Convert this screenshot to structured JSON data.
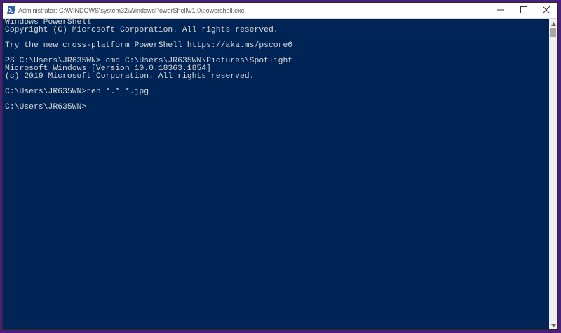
{
  "window": {
    "title": "Administrator: C:\\WINDOWS\\system32\\WindowsPowerShell\\v1.0\\powershell.exe",
    "icon": "powershell-icon"
  },
  "titlebar": {
    "minimize_icon": "minimize-icon",
    "maximize_icon": "maximize-icon",
    "close_icon": "close-icon"
  },
  "console": {
    "lines": [
      "Windows PowerShell",
      "Copyright (C) Microsoft Corporation. All rights reserved.",
      "",
      "Try the new cross-platform PowerShell https://aka.ms/pscore6",
      "",
      "PS C:\\Users\\JR635WN> cmd C:\\Users\\JR635WN\\Pictures\\Spotlight",
      "Microsoft Windows [Version 10.0.18363.1854]",
      "(c) 2019 Microsoft Corporation. All rights reserved.",
      "",
      "C:\\Users\\JR635WN>ren *.* *.jpg",
      "",
      "C:\\Users\\JR635WN>"
    ]
  },
  "scrollbar": {
    "up_icon": "scroll-up-arrow-icon",
    "down_icon": "scroll-down-arrow-icon"
  },
  "colors": {
    "console_bg": "#012456",
    "console_fg": "#d8d8d8",
    "frame": "#4b1e7c"
  }
}
